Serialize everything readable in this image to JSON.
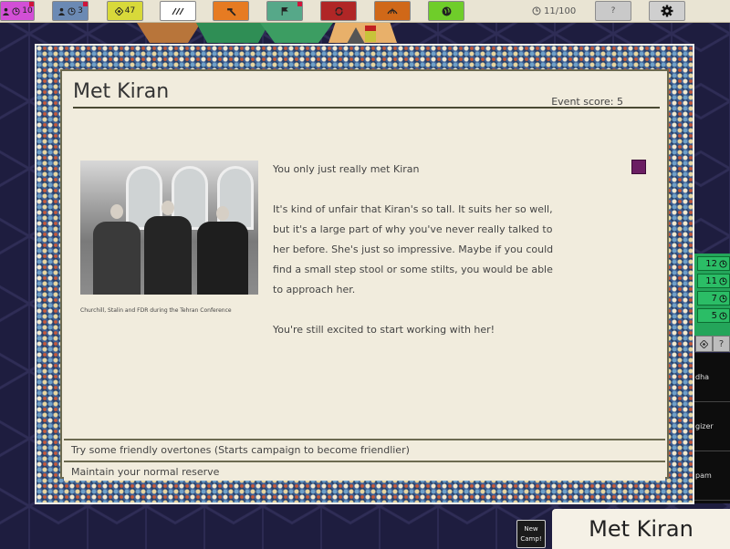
{
  "topbar": {
    "resources": [
      {
        "name": "people",
        "value": "10",
        "color": "#d24fd6"
      },
      {
        "name": "time",
        "value": "3",
        "color": "#6b8ab4"
      },
      {
        "name": "influence",
        "value": "47",
        "color": "#d8d93a"
      },
      {
        "name": "writing",
        "value": "",
        "color": "#ffffff"
      },
      {
        "name": "build",
        "value": "",
        "color": "#e67b22"
      },
      {
        "name": "arms",
        "value": "",
        "color": "#56a889"
      },
      {
        "name": "cycle",
        "value": "",
        "color": "#b02626"
      },
      {
        "name": "trade",
        "value": "",
        "color": "#d06818"
      },
      {
        "name": "globe",
        "value": "",
        "color": "#6fcd2a"
      }
    ],
    "turn_counter": "11/100",
    "help_label": "?"
  },
  "dialog": {
    "title": "Met Kiran",
    "event_score": "Event score: 5",
    "image_caption": "Churchill, Stalin and FDR during the Tehran Conference",
    "paragraphs": [
      "You only just really met Kiran",
      "It's kind of unfair that Kiran's so tall. It suits her so well, but it's a large part of why you've never really talked to her before. She's just so impressive. Maybe if you could find a small step stool or some stilts, you would be able to approach her.",
      "You're still excited to start working with her!"
    ],
    "marker_color": "#6b1e63",
    "options": [
      "Try some friendly overtones (Starts campaign to become friendlier)",
      "Maintain your normal reserve"
    ]
  },
  "side_panel": {
    "counters": [
      "12",
      "11",
      "7",
      "5"
    ],
    "icons": [
      "diamond",
      "?"
    ],
    "list_items": [
      "dha",
      "gizer",
      "pam"
    ]
  },
  "bottom": {
    "new_camp_label_1": "New",
    "new_camp_label_2": "Camp!",
    "title_plate": "Met Kiran"
  }
}
